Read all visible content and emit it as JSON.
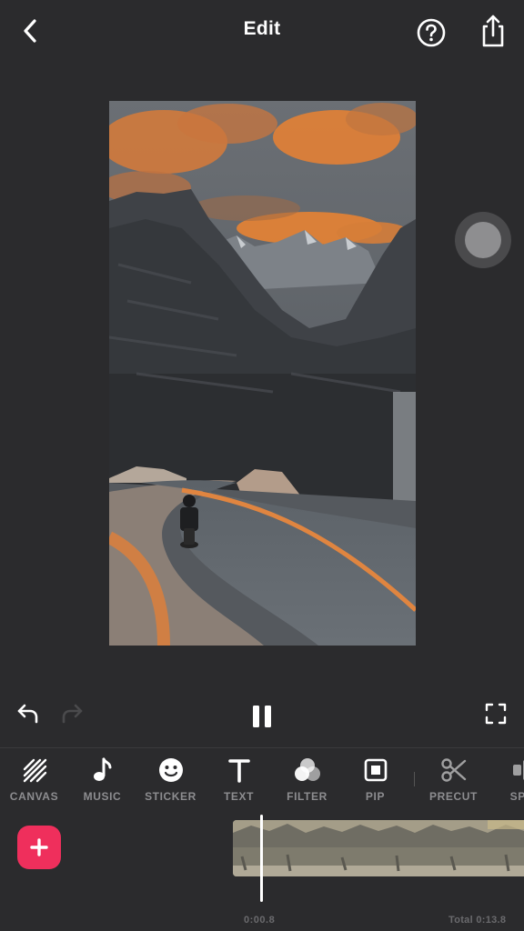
{
  "header": {
    "title": "Edit",
    "back_icon": "chevron-left-icon",
    "help_icon": "question-circle-icon",
    "share_icon": "share-upload-icon"
  },
  "preview": {
    "content": "video-frame",
    "sky_accent_color": "#e0833a"
  },
  "record_button": {
    "icon": "record-icon"
  },
  "playback": {
    "undo_icon": "undo-icon",
    "redo_icon": "redo-icon",
    "redo_enabled": false,
    "pause_icon": "pause-icon",
    "fullscreen_icon": "fullscreen-icon"
  },
  "toolbar": {
    "items": [
      {
        "label": "CANVAS",
        "icon": "canvas-icon"
      },
      {
        "label": "MUSIC",
        "icon": "music-note-icon"
      },
      {
        "label": "STICKER",
        "icon": "smiley-icon"
      },
      {
        "label": "TEXT",
        "icon": "text-icon"
      },
      {
        "label": "FILTER",
        "icon": "filter-icon"
      },
      {
        "label": "PIP",
        "icon": "pip-icon"
      },
      {
        "label": "PRECUT",
        "icon": "scissors-icon"
      },
      {
        "label": "SPE",
        "icon": "speed-icon"
      }
    ]
  },
  "timeline": {
    "add_icon": "plus-icon",
    "current_time": "0:00.8",
    "total_time": "Total 0:13.8"
  },
  "colors": {
    "background": "#2b2b2d",
    "accent": "#ef2f5c",
    "label": "#8d8d90"
  }
}
